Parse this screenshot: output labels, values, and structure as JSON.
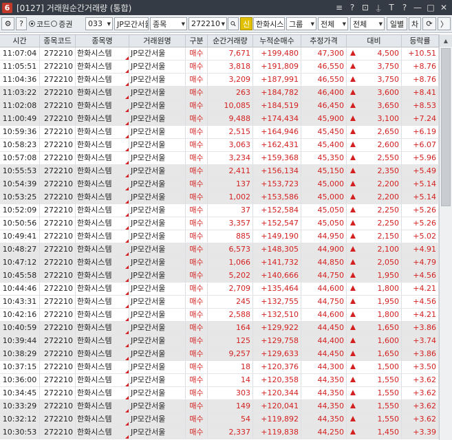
{
  "window": {
    "app_number": "6",
    "title": "[0127] 거래원순간거래량 (통합)",
    "title_buttons": [
      "≡",
      "?",
      "⊡",
      "⍊",
      "T",
      "?",
      "—",
      "□",
      "✕"
    ]
  },
  "toolbar": {
    "gear": "⚙",
    "help": "?",
    "radio_code": "코드",
    "radio_broker": "증권",
    "code_value": "033",
    "broker_name": "JP모간서울",
    "type_value": "종목",
    "stock_code": "272210",
    "sin_badge": "신",
    "stock_name": "한화시스템",
    "group_value": "그룹",
    "all1": "전체",
    "all2": "전체",
    "period": "일별",
    "diff": "차",
    "refresh": "⟳",
    "collapse": "〉"
  },
  "table": {
    "headers": [
      "시간",
      "종목코드",
      "종목명",
      "거래원명",
      "구분",
      "순간거래량",
      "누적순매수",
      "추정가격",
      "대비",
      "등락률"
    ],
    "rows": [
      {
        "time": "11:07:04",
        "code": "272210",
        "name": "한화시스템",
        "broker": "JP모간서울",
        "side": "매수",
        "qty": "7,671",
        "cum": "+199,480",
        "price": "47,300",
        "diff": "4,500",
        "rate": "+10.51"
      },
      {
        "time": "11:05:51",
        "code": "272210",
        "name": "한화시스템",
        "broker": "JP모간서울",
        "side": "매수",
        "qty": "3,818",
        "cum": "+191,809",
        "price": "46,550",
        "diff": "3,750",
        "rate": "+8.76"
      },
      {
        "time": "11:04:36",
        "code": "272210",
        "name": "한화시스템",
        "broker": "JP모간서울",
        "side": "매수",
        "qty": "3,209",
        "cum": "+187,991",
        "price": "46,550",
        "diff": "3,750",
        "rate": "+8.76"
      },
      {
        "time": "11:03:22",
        "code": "272210",
        "name": "한화시스템",
        "broker": "JP모간서울",
        "side": "매수",
        "qty": "263",
        "cum": "+184,782",
        "price": "46,400",
        "diff": "3,600",
        "rate": "+8.41"
      },
      {
        "time": "11:02:08",
        "code": "272210",
        "name": "한화시스템",
        "broker": "JP모간서울",
        "side": "매수",
        "qty": "10,085",
        "cum": "+184,519",
        "price": "46,450",
        "diff": "3,650",
        "rate": "+8.53"
      },
      {
        "time": "11:00:49",
        "code": "272210",
        "name": "한화시스템",
        "broker": "JP모간서울",
        "side": "매수",
        "qty": "9,488",
        "cum": "+174,434",
        "price": "45,900",
        "diff": "3,100",
        "rate": "+7.24"
      },
      {
        "time": "10:59:36",
        "code": "272210",
        "name": "한화시스템",
        "broker": "JP모간서울",
        "side": "매수",
        "qty": "2,515",
        "cum": "+164,946",
        "price": "45,450",
        "diff": "2,650",
        "rate": "+6.19"
      },
      {
        "time": "10:58:23",
        "code": "272210",
        "name": "한화시스템",
        "broker": "JP모간서울",
        "side": "매수",
        "qty": "3,063",
        "cum": "+162,431",
        "price": "45,400",
        "diff": "2,600",
        "rate": "+6.07"
      },
      {
        "time": "10:57:08",
        "code": "272210",
        "name": "한화시스템",
        "broker": "JP모간서울",
        "side": "매수",
        "qty": "3,234",
        "cum": "+159,368",
        "price": "45,350",
        "diff": "2,550",
        "rate": "+5.96"
      },
      {
        "time": "10:55:53",
        "code": "272210",
        "name": "한화시스템",
        "broker": "JP모간서울",
        "side": "매수",
        "qty": "2,411",
        "cum": "+156,134",
        "price": "45,150",
        "diff": "2,350",
        "rate": "+5.49"
      },
      {
        "time": "10:54:39",
        "code": "272210",
        "name": "한화시스템",
        "broker": "JP모간서울",
        "side": "매수",
        "qty": "137",
        "cum": "+153,723",
        "price": "45,000",
        "diff": "2,200",
        "rate": "+5.14"
      },
      {
        "time": "10:53:25",
        "code": "272210",
        "name": "한화시스템",
        "broker": "JP모간서울",
        "side": "매수",
        "qty": "1,002",
        "cum": "+153,586",
        "price": "45,000",
        "diff": "2,200",
        "rate": "+5.14"
      },
      {
        "time": "10:52:09",
        "code": "272210",
        "name": "한화시스템",
        "broker": "JP모간서울",
        "side": "매수",
        "qty": "37",
        "cum": "+152,584",
        "price": "45,050",
        "diff": "2,250",
        "rate": "+5.26"
      },
      {
        "time": "10:50:56",
        "code": "272210",
        "name": "한화시스템",
        "broker": "JP모간서울",
        "side": "매수",
        "qty": "3,357",
        "cum": "+152,547",
        "price": "45,050",
        "diff": "2,250",
        "rate": "+5.26"
      },
      {
        "time": "10:49:41",
        "code": "272210",
        "name": "한화시스템",
        "broker": "JP모간서울",
        "side": "매수",
        "qty": "885",
        "cum": "+149,190",
        "price": "44,950",
        "diff": "2,150",
        "rate": "+5.02"
      },
      {
        "time": "10:48:27",
        "code": "272210",
        "name": "한화시스템",
        "broker": "JP모간서울",
        "side": "매수",
        "qty": "6,573",
        "cum": "+148,305",
        "price": "44,900",
        "diff": "2,100",
        "rate": "+4.91"
      },
      {
        "time": "10:47:12",
        "code": "272210",
        "name": "한화시스템",
        "broker": "JP모간서울",
        "side": "매수",
        "qty": "1,066",
        "cum": "+141,732",
        "price": "44,850",
        "diff": "2,050",
        "rate": "+4.79"
      },
      {
        "time": "10:45:58",
        "code": "272210",
        "name": "한화시스템",
        "broker": "JP모간서울",
        "side": "매수",
        "qty": "5,202",
        "cum": "+140,666",
        "price": "44,750",
        "diff": "1,950",
        "rate": "+4.56"
      },
      {
        "time": "10:44:46",
        "code": "272210",
        "name": "한화시스템",
        "broker": "JP모간서울",
        "side": "매수",
        "qty": "2,709",
        "cum": "+135,464",
        "price": "44,600",
        "diff": "1,800",
        "rate": "+4.21"
      },
      {
        "time": "10:43:31",
        "code": "272210",
        "name": "한화시스템",
        "broker": "JP모간서울",
        "side": "매수",
        "qty": "245",
        "cum": "+132,755",
        "price": "44,750",
        "diff": "1,950",
        "rate": "+4.56"
      },
      {
        "time": "10:42:16",
        "code": "272210",
        "name": "한화시스템",
        "broker": "JP모간서울",
        "side": "매수",
        "qty": "2,588",
        "cum": "+132,510",
        "price": "44,600",
        "diff": "1,800",
        "rate": "+4.21"
      },
      {
        "time": "10:40:59",
        "code": "272210",
        "name": "한화시스템",
        "broker": "JP모간서울",
        "side": "매수",
        "qty": "164",
        "cum": "+129,922",
        "price": "44,450",
        "diff": "1,650",
        "rate": "+3.86"
      },
      {
        "time": "10:39:44",
        "code": "272210",
        "name": "한화시스템",
        "broker": "JP모간서울",
        "side": "매수",
        "qty": "125",
        "cum": "+129,758",
        "price": "44,400",
        "diff": "1,600",
        "rate": "+3.74"
      },
      {
        "time": "10:38:29",
        "code": "272210",
        "name": "한화시스템",
        "broker": "JP모간서울",
        "side": "매수",
        "qty": "9,257",
        "cum": "+129,633",
        "price": "44,450",
        "diff": "1,650",
        "rate": "+3.86"
      },
      {
        "time": "10:37:15",
        "code": "272210",
        "name": "한화시스템",
        "broker": "JP모간서울",
        "side": "매수",
        "qty": "18",
        "cum": "+120,376",
        "price": "44,300",
        "diff": "1,500",
        "rate": "+3.50"
      },
      {
        "time": "10:36:00",
        "code": "272210",
        "name": "한화시스템",
        "broker": "JP모간서울",
        "side": "매수",
        "qty": "14",
        "cum": "+120,358",
        "price": "44,350",
        "diff": "1,550",
        "rate": "+3.62"
      },
      {
        "time": "10:34:45",
        "code": "272210",
        "name": "한화시스템",
        "broker": "JP모간서울",
        "side": "매수",
        "qty": "303",
        "cum": "+120,344",
        "price": "44,350",
        "diff": "1,550",
        "rate": "+3.62"
      },
      {
        "time": "10:33:29",
        "code": "272210",
        "name": "한화시스템",
        "broker": "JP모간서울",
        "side": "매수",
        "qty": "149",
        "cum": "+120,041",
        "price": "44,350",
        "diff": "1,550",
        "rate": "+3.62"
      },
      {
        "time": "10:32:12",
        "code": "272210",
        "name": "한화시스템",
        "broker": "JP모간서울",
        "side": "매수",
        "qty": "54",
        "cum": "+119,892",
        "price": "44,350",
        "diff": "1,550",
        "rate": "+3.62"
      },
      {
        "time": "10:30:53",
        "code": "272210",
        "name": "한화시스템",
        "broker": "JP모간서울",
        "side": "매수",
        "qty": "2,337",
        "cum": "+119,838",
        "price": "44,250",
        "diff": "1,450",
        "rate": "+3.39"
      }
    ]
  },
  "colors": {
    "up": "#d42020",
    "alt_row": "#e7e7e7",
    "header": "#e4e8ec",
    "titlebar": "#353b44"
  }
}
